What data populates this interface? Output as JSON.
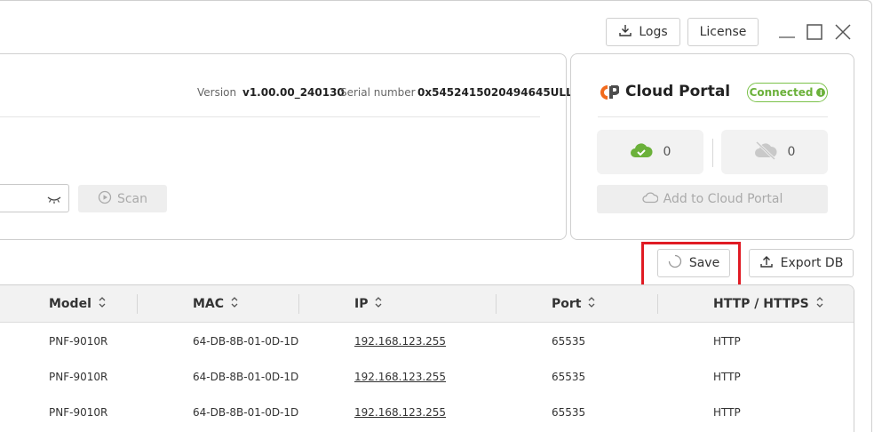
{
  "header": {
    "logs_label": "Logs",
    "license_label": "License"
  },
  "device": {
    "version_label": "Version",
    "version_value": "v1.00.00_240130",
    "serial_label": "Serial number",
    "serial_value": "0x5452415020494645ULL",
    "scan_label": "Scan"
  },
  "cloud": {
    "title": "Cloud Portal",
    "status": "Connected",
    "online_count": "0",
    "offline_count": "0",
    "add_label": "Add to Cloud Portal"
  },
  "actions": {
    "save_label": "Save",
    "export_label": "Export DB"
  },
  "table": {
    "columns": [
      "Model",
      "MAC",
      "IP",
      "Port",
      "HTTP / HTTPS"
    ],
    "rows": [
      [
        "PNF-9010R",
        "64-DB-8B-01-0D-1D",
        "192.168.123.255",
        "65535",
        "HTTP"
      ],
      [
        "PNF-9010R",
        "64-DB-8B-01-0D-1D",
        "192.168.123.255",
        "65535",
        "HTTP"
      ],
      [
        "PNF-9010R",
        "64-DB-8B-01-0D-1D",
        "192.168.123.255",
        "65535",
        "HTTP"
      ]
    ]
  },
  "colors": {
    "connected": "#6bb13a",
    "highlight": "#e01b24",
    "logo_orange": "#f26b1d"
  }
}
